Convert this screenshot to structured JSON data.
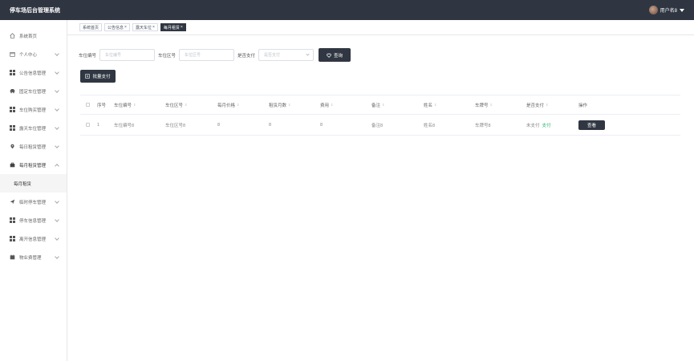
{
  "app": {
    "title": "停车场后台管理系统"
  },
  "user": {
    "name": "用户名8"
  },
  "sidebar": {
    "items": [
      {
        "label": "系统首页",
        "icon": "home-icon"
      },
      {
        "label": "个人中心",
        "icon": "calendar-icon"
      },
      {
        "label": "公告信息管理",
        "icon": "grid-icon"
      },
      {
        "label": "固定车位管理",
        "icon": "car-icon"
      },
      {
        "label": "车位购买管理",
        "icon": "grid-icon"
      },
      {
        "label": "露天车位管理",
        "icon": "grid-icon"
      },
      {
        "label": "每日租赁管理",
        "icon": "location-pin-icon"
      },
      {
        "label": "每月租赁管理",
        "icon": "briefcase-icon"
      },
      {
        "label": "临时停车管理",
        "icon": "send-icon"
      },
      {
        "label": "停车信息管理",
        "icon": "grid-icon"
      },
      {
        "label": "离开信息管理",
        "icon": "grid-icon"
      },
      {
        "label": "物业费管理",
        "icon": "calendar-icon"
      }
    ],
    "submenu": {
      "label": "每月租赁"
    }
  },
  "tags": [
    {
      "label": "系统首页",
      "closable": false
    },
    {
      "label": "公告信息",
      "closable": true
    },
    {
      "label": "露天车位",
      "closable": true
    },
    {
      "label": "每月租赁",
      "closable": true
    }
  ],
  "search": {
    "field1_label": "车位编号",
    "field1_placeholder": "车位编号",
    "field2_label": "车位区号",
    "field2_placeholder": "车位区号",
    "field3_label": "是否支付",
    "field3_placeholder": "是否支付",
    "query_button": "查询"
  },
  "toolbar": {
    "batch_pay": "批量支付"
  },
  "table": {
    "headers": [
      "序号",
      "车位编号",
      "车位区号",
      "每月价格",
      "租赁月数",
      "费用",
      "备注",
      "姓名",
      "车牌号",
      "是否支付",
      "操作"
    ],
    "rows": [
      {
        "index": "1",
        "parking_no": "车位编号8",
        "zone_no": "车位区号8",
        "monthly_price": "8",
        "months": "8",
        "fee": "8",
        "remark": "备注8",
        "name": "姓名8",
        "plate": "车牌号8",
        "paid_status": "未支付",
        "pay_link": "支付",
        "view_button": "查看"
      }
    ]
  },
  "colors": {
    "topbar": "#2f3642",
    "button": "#303742",
    "pay_link": "#2bb673"
  }
}
